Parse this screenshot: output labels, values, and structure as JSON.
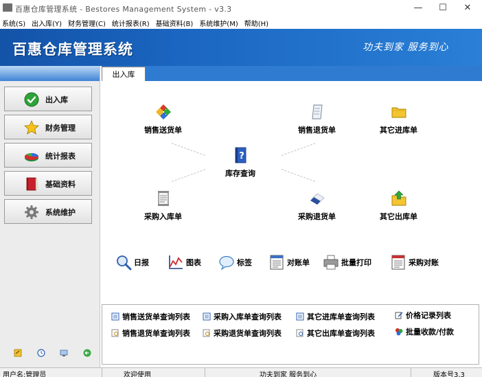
{
  "window": {
    "title": "百惠仓库管理系统 - Bestores Management System - v3.3",
    "controls": [
      "minimize-icon",
      "maximize-icon",
      "close-icon"
    ]
  },
  "menubar": [
    "系统(S)",
    "出入库(Y)",
    "财务管理(C)",
    "统计报表(R)",
    "基础资料(B)",
    "系统维护(M)",
    "帮助(H)"
  ],
  "banner": {
    "title": "百惠仓库管理系统",
    "slogan": "功夫到家 服务到心"
  },
  "sidebar": {
    "items": [
      {
        "label": "出入库",
        "icon": "check-icon",
        "active": true
      },
      {
        "label": "财务管理",
        "icon": "star-icon"
      },
      {
        "label": "统计报表",
        "icon": "pie-chart-icon"
      },
      {
        "label": "基础资料",
        "icon": "book-icon"
      },
      {
        "label": "系统维护",
        "icon": "gear-icon"
      }
    ],
    "footer_icons": [
      "notepad-icon",
      "clock-icon",
      "monitor-icon",
      "back-arrow-icon"
    ]
  },
  "tab": {
    "label": "出入库"
  },
  "actions": {
    "sales_delivery": "销售送货单",
    "sales_return": "销售退货单",
    "other_inbound": "其它进库单",
    "stock_query": "库存查询",
    "purchase_inbound": "采购入库单",
    "purchase_return": "采购退货单",
    "other_outbound": "其它出库单"
  },
  "tools": [
    "日报",
    "图表",
    "标签",
    "对账单",
    "批量打印",
    "采购对账"
  ],
  "links": [
    [
      "销售送货单查询列表",
      "采购入库单查询列表",
      "其它进库单查询列表",
      "价格记录列表"
    ],
    [
      "销售退货单查询列表",
      "采购退货单查询列表",
      "其它出库单查询列表",
      "批量收款/付款"
    ]
  ],
  "status": {
    "user": "用户名:管理员",
    "welcome": "欢迎使用",
    "slogan": "功夫到家 服务到心",
    "version": "版本号3.3"
  },
  "colors": {
    "banner": "#1b67c2",
    "tab_header": "#2f7bd2",
    "sidebar": "#ececec"
  }
}
